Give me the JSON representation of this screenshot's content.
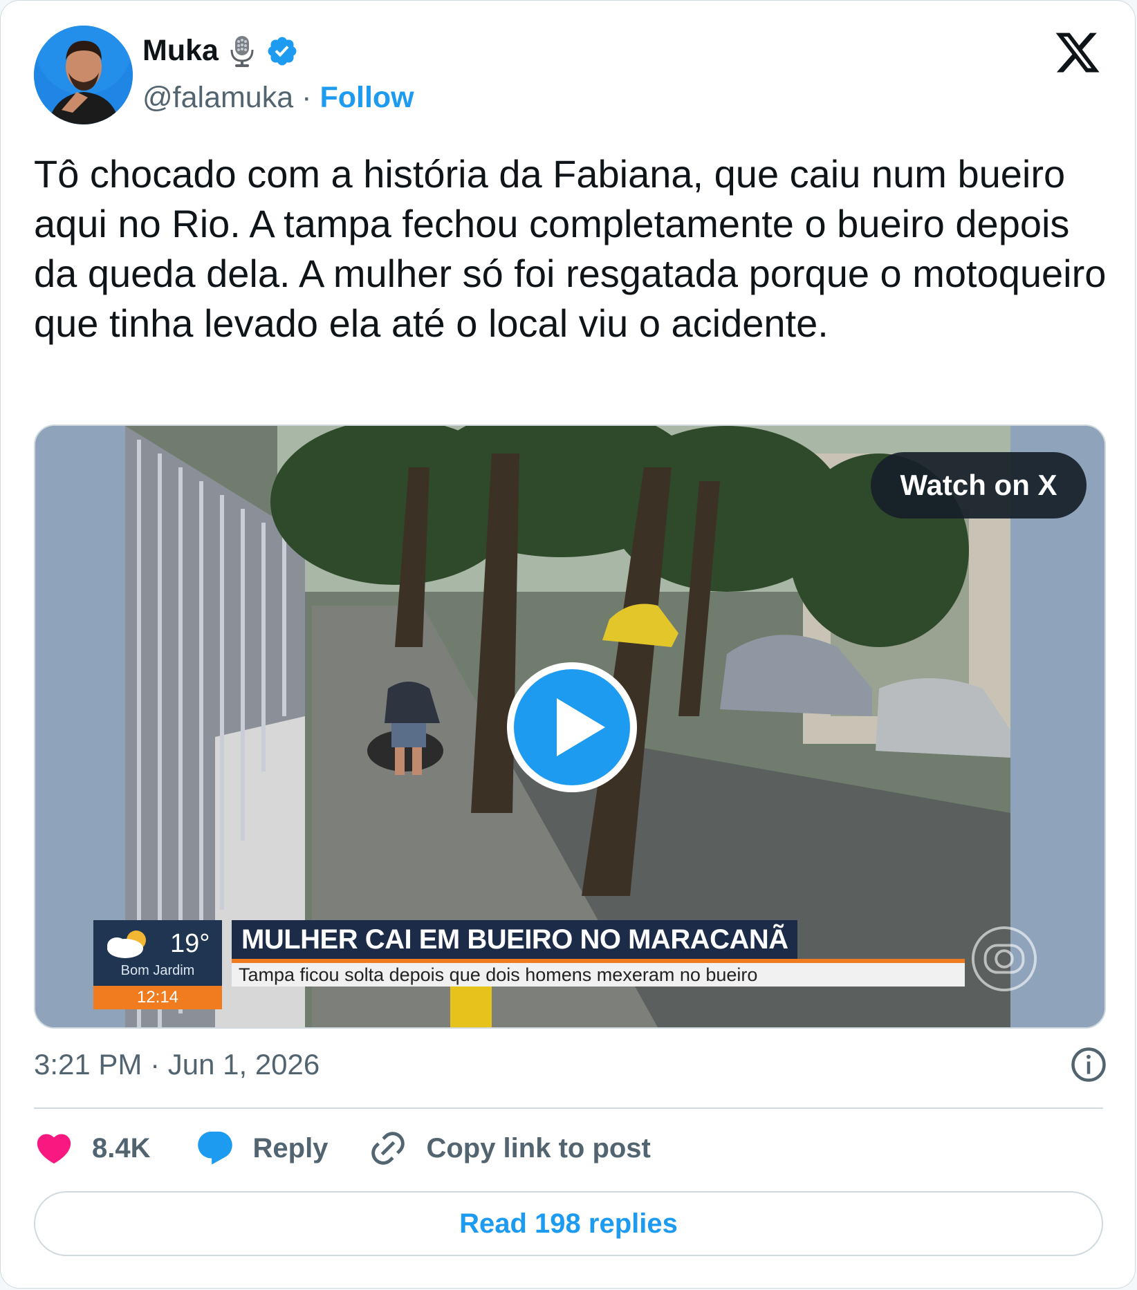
{
  "author": {
    "name": "Muka",
    "name_emoji": "microphone-icon",
    "verified": true,
    "handle": "@falamuka",
    "separator": "·",
    "follow_label": "Follow"
  },
  "tweet": {
    "text": "Tô chocado com a história da Fabiana, que caiu num bueiro aqui no Rio. A tampa fechou completamente o bueiro depois da queda dela. A mulher só foi resgatada porque o motoqueiro que tinha levado ela até o local viu o acidente."
  },
  "media": {
    "watch_label": "Watch on X",
    "overlay": {
      "temperature": "19°",
      "city": "Bom Jardim",
      "time": "12:14",
      "headline": "MULHER CAI EM BUEIRO NO MARACANÃ",
      "subheadline": "Tampa ficou solta depois que dois homens mexeram no bueiro"
    }
  },
  "meta": {
    "timestamp": "3:21 PM · Jun 1, 2026"
  },
  "actions": {
    "likes": "8.4K",
    "reply_label": "Reply",
    "copy_label": "Copy link to post"
  },
  "read_replies": "Read 198 replies",
  "colors": {
    "accent": "#1d9bf0",
    "like": "#f91880",
    "text": "#0f1419",
    "secondary": "#536471",
    "border": "#cfd9de"
  }
}
